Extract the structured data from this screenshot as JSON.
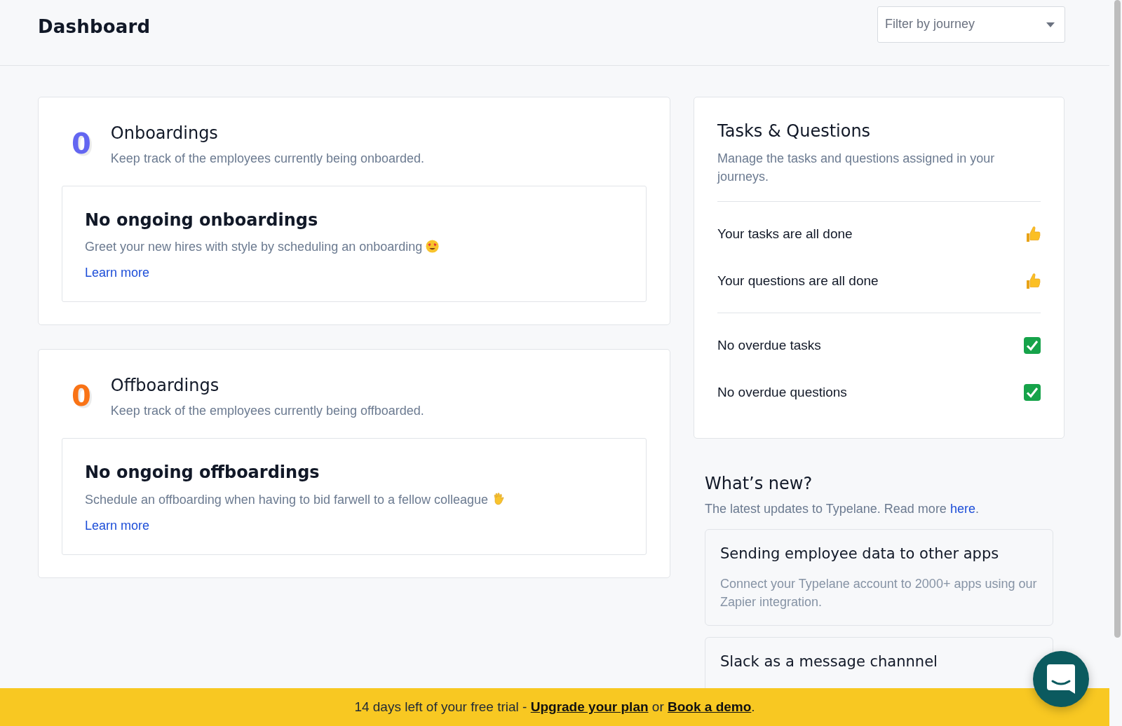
{
  "header": {
    "title": "Dashboard",
    "filter": {
      "placeholder": "Filter by journey"
    }
  },
  "journeys": [
    {
      "count": "0",
      "color": "#6366f1",
      "title": "Onboardings",
      "subtitle": "Keep track of the employees currently being onboarded.",
      "empty_title": "No ongoing onboardings",
      "empty_text": "Greet your new hires with style by scheduling an onboarding",
      "kind": "onboarding",
      "link": "Learn more"
    },
    {
      "count": "0",
      "color": "#f97316",
      "title": "Offboardings",
      "subtitle": "Keep track of the employees currently being offboarded.",
      "empty_title": "No ongoing offboardings",
      "empty_text": "Schedule an offboarding when having to bid farwell to a fellow colleague",
      "kind": "offboarding",
      "link": "Learn more"
    }
  ],
  "tasks": {
    "title": "Tasks & Questions",
    "subtitle": "Manage the tasks and questions assigned in your journeys.",
    "groups": [
      [
        {
          "label": "Your tasks are all done",
          "kind": "thumb"
        },
        {
          "label": "Your questions are all done",
          "kind": "thumb"
        }
      ],
      [
        {
          "label": "No overdue tasks",
          "kind": "check"
        },
        {
          "label": "No overdue questions",
          "kind": "check"
        }
      ]
    ]
  },
  "whats_new": {
    "title": "What’s new?",
    "text": "The latest updates to Typelane. Read more ",
    "link": "here",
    "end": ".",
    "items": [
      {
        "title": "Sending employee data to other apps",
        "text": "Connect your Typelane account to 2000+ apps using our Zapier integration."
      },
      {
        "title": "Slack as a message channnel"
      }
    ]
  },
  "banner": {
    "text": "14 days left of your free trial - ",
    "link1": "Upgrade your plan",
    "middle": " or ",
    "link2": "Book a demo",
    "end": "."
  }
}
